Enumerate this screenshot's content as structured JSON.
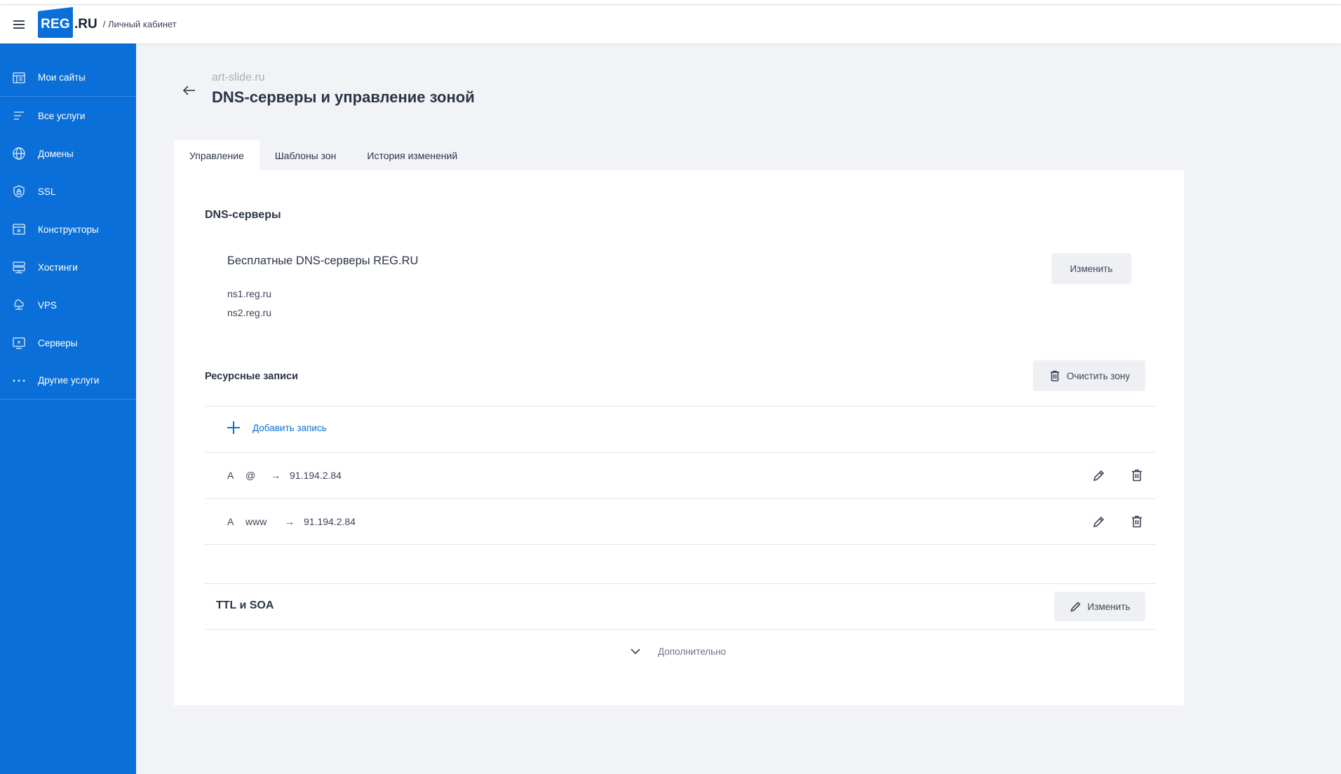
{
  "header": {
    "logo_reg": "REG",
    "logo_ru": ".RU",
    "breadcrumb": "/ Личный кабинет"
  },
  "sidebar": {
    "items": [
      {
        "label": "Мои сайты",
        "icon": "sites-icon"
      },
      {
        "label": "Все услуги",
        "icon": "list-icon"
      },
      {
        "label": "Домены",
        "icon": "globe-icon"
      },
      {
        "label": "SSL",
        "icon": "shield-lock-icon"
      },
      {
        "label": "Конструкторы",
        "icon": "builder-icon"
      },
      {
        "label": "Хостинги",
        "icon": "hosting-icon"
      },
      {
        "label": "VPS",
        "icon": "vps-icon"
      },
      {
        "label": "Серверы",
        "icon": "server-icon"
      },
      {
        "label": "Другие услуги",
        "icon": "more-dots-icon"
      }
    ]
  },
  "page": {
    "domain": "art-slide.ru",
    "title": "DNS-серверы и управление зоной"
  },
  "tabs": [
    {
      "label": "Управление",
      "active": true
    },
    {
      "label": "Шаблоны зон",
      "active": false
    },
    {
      "label": "История изменений",
      "active": false
    }
  ],
  "dns_servers": {
    "title": "DNS-серверы",
    "name": "Бесплатные DNS-серверы REG.RU",
    "servers": [
      "ns1.reg.ru",
      "ns2.reg.ru"
    ],
    "change_label": "Изменить"
  },
  "resource_records": {
    "title": "Ресурсные записи",
    "clear_label": "Очистить зону",
    "add_label": "Добавить запись",
    "records": [
      {
        "type": "A",
        "host": "@",
        "arrow": "→",
        "value": "91.194.2.84"
      },
      {
        "type": "A",
        "host": "www",
        "arrow": "→",
        "value": "91.194.2.84"
      }
    ]
  },
  "ttl_soa": {
    "title": "TTL и SOA",
    "change_label": "Изменить"
  },
  "more_label": "Дополнительно",
  "colors": {
    "brand": "#0a6fd8",
    "background": "#f2f3f6",
    "button_grey": "#eef0f4"
  }
}
